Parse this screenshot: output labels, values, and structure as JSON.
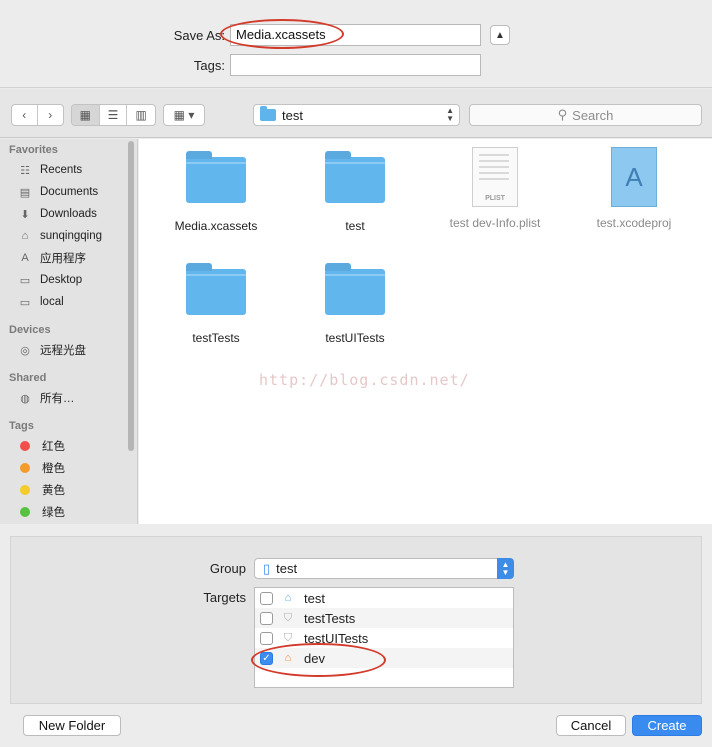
{
  "save_as": {
    "label": "Save As:",
    "value": "Media.xcassets"
  },
  "tags": {
    "label": "Tags:",
    "value": ""
  },
  "toolbar": {
    "back_icon": "chevron-left-icon",
    "forward_icon": "chevron-right-icon",
    "view_modes": [
      "icon-view",
      "list-view",
      "column-view"
    ],
    "arrange_icon": "arrange-grid-icon",
    "location": "test",
    "search_placeholder": "Search"
  },
  "sidebar": {
    "favorites_title": "Favorites",
    "favorites": [
      {
        "label": "Recents",
        "icon": "recents-icon"
      },
      {
        "label": "Documents",
        "icon": "documents-icon"
      },
      {
        "label": "Downloads",
        "icon": "downloads-icon"
      },
      {
        "label": "sunqingqing",
        "icon": "home-icon"
      },
      {
        "label": "应用程序",
        "icon": "applications-icon"
      },
      {
        "label": "Desktop",
        "icon": "desktop-icon"
      },
      {
        "label": "local",
        "icon": "folder-icon"
      }
    ],
    "devices_title": "Devices",
    "devices": [
      {
        "label": "远程光盘",
        "icon": "disc-icon"
      }
    ],
    "shared_title": "Shared",
    "shared": [
      {
        "label": "所有…",
        "icon": "network-icon"
      }
    ],
    "tags_title": "Tags",
    "tags": [
      {
        "label": "红色",
        "color": "#f0504b"
      },
      {
        "label": "橙色",
        "color": "#f59a2d"
      },
      {
        "label": "黄色",
        "color": "#f5cb2d"
      },
      {
        "label": "绿色",
        "color": "#56c23f"
      }
    ]
  },
  "files": [
    {
      "name": "Media.xcassets",
      "kind": "folder"
    },
    {
      "name": "test",
      "kind": "folder"
    },
    {
      "name": "test dev-Info.plist",
      "kind": "plist",
      "badge": "PLIST"
    },
    {
      "name": "test.xcodeproj",
      "kind": "xcodeproj"
    },
    {
      "name": "testTests",
      "kind": "folder"
    },
    {
      "name": "testUITests",
      "kind": "folder"
    }
  ],
  "watermark": "http://blog.csdn.net/",
  "group": {
    "label": "Group",
    "value": "test"
  },
  "targets": {
    "label": "Targets",
    "items": [
      {
        "name": "test",
        "checked": false
      },
      {
        "name": "testTests",
        "checked": false
      },
      {
        "name": "testUITests",
        "checked": false
      },
      {
        "name": "dev",
        "checked": true
      }
    ]
  },
  "buttons": {
    "new_folder": "New Folder",
    "cancel": "Cancel",
    "create": "Create"
  },
  "colors": {
    "accent": "#3a8bf0",
    "annotation": "#d23a2a",
    "folder": "#61b6ee"
  }
}
